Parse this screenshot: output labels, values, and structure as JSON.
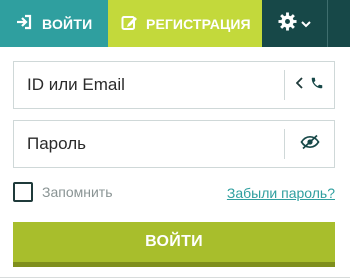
{
  "topbar": {
    "login_label": "ВОЙТИ",
    "register_label": "РЕГИСТРАЦИЯ",
    "login_icon": "sign-in-icon",
    "register_icon": "edit-icon",
    "settings_icon": "gear-icon",
    "settings_caret_icon": "chevron-down-icon"
  },
  "form": {
    "email_placeholder": "ID или Email",
    "password_placeholder": "Пароль",
    "email_side_icons": [
      "chevron-left-icon",
      "phone-icon"
    ],
    "password_side_icon": "eye-slash-icon",
    "remember_label": "Запомнить",
    "forgot_label": "Забыли пароль?",
    "submit_label": "ВОЙТИ"
  },
  "colors": {
    "teal": "#2f9f9f",
    "lime": "#c3d93b",
    "dark_teal": "#174848",
    "submit_green": "#a8be2c"
  }
}
